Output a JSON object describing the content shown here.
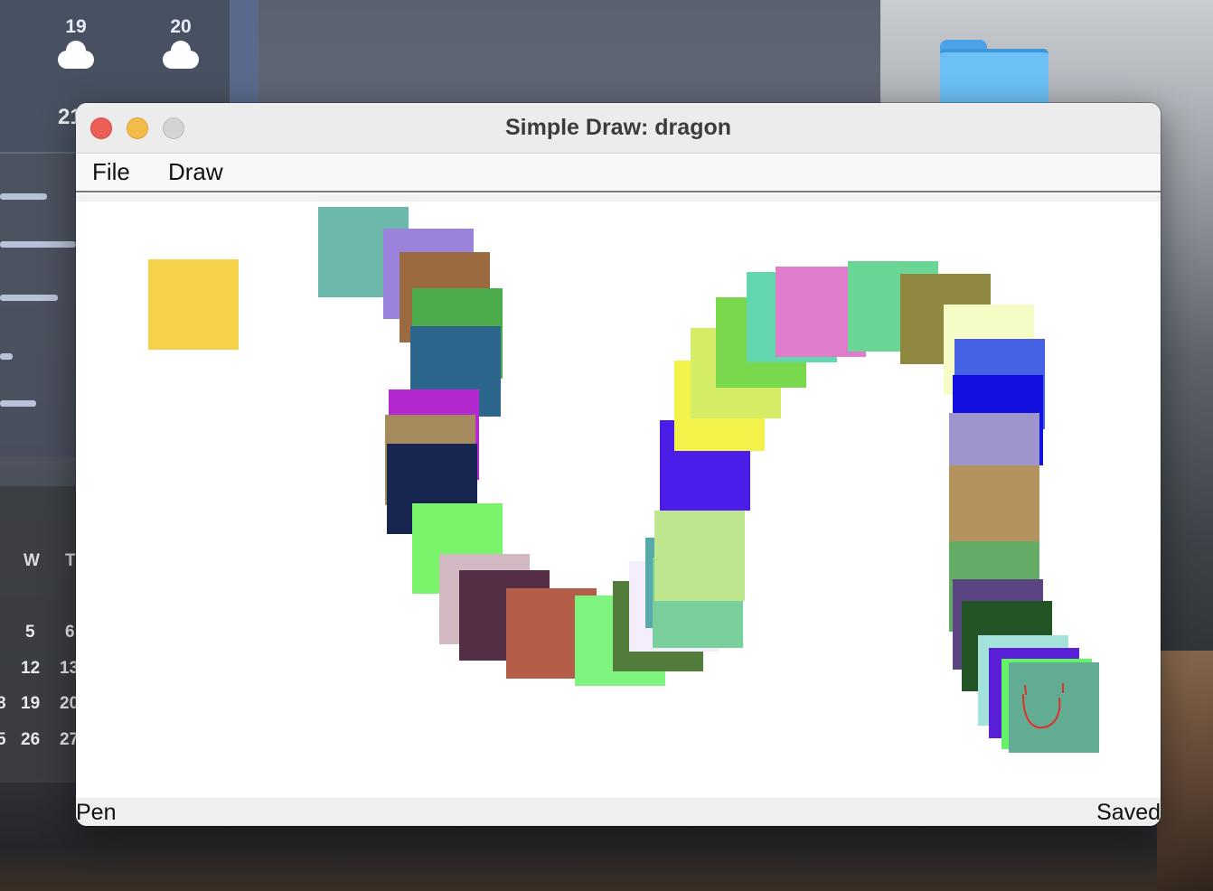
{
  "window": {
    "title": "Simple Draw: dragon"
  },
  "menubar": {
    "items": [
      "File",
      "Draw"
    ]
  },
  "status": {
    "mode": "Pen",
    "save_state": "Saved"
  },
  "desktop": {
    "weather": {
      "days": [
        "19",
        "20"
      ],
      "temp_partial": "21"
    },
    "calendar": {
      "headers": [
        "W",
        "T"
      ],
      "rows": [
        [
          "5",
          "6"
        ],
        [
          "12",
          "13"
        ],
        [
          "19",
          "20"
        ],
        [
          "26",
          "27"
        ]
      ],
      "partial_col": [
        "",
        "",
        "8",
        "5"
      ]
    }
  },
  "canvas": {
    "shapes": [
      {
        "color": "#f5d24a"
      },
      {
        "color": "#6cb8ac"
      },
      {
        "color": "#9b82dc"
      },
      {
        "color": "#9c6a40"
      },
      {
        "color": "#4cac4c"
      },
      {
        "color": "#2c668c"
      },
      {
        "color": "#b428d0"
      },
      {
        "color": "#a48a5c"
      },
      {
        "color": "#162650"
      },
      {
        "color": "#7af46a"
      },
      {
        "color": "#d2b8c0"
      },
      {
        "color": "#542e44"
      },
      {
        "color": "#b45e4a"
      },
      {
        "color": "#7ef47e"
      },
      {
        "color": "#527c3a"
      },
      {
        "color": "#f4eefc"
      },
      {
        "color": "#58aaaa"
      },
      {
        "color": "#7ad09c"
      },
      {
        "color": "#bee68e"
      },
      {
        "color": "#4c1ce8"
      },
      {
        "color": "#f2f24a"
      },
      {
        "color": "#d4ec66"
      },
      {
        "color": "#7ad84c"
      },
      {
        "color": "#62d6ac"
      },
      {
        "color": "#e07ccc"
      },
      {
        "color": "#6ad696"
      },
      {
        "color": "#908840"
      },
      {
        "color": "#f6fcc6"
      },
      {
        "color": "#4662e4"
      },
      {
        "color": "#1410e0"
      },
      {
        "color": "#9c96cc"
      },
      {
        "color": "#b4925e"
      },
      {
        "color": "#64ac66"
      },
      {
        "color": "#5a4482"
      },
      {
        "color": "#225426"
      },
      {
        "color": "#a4e2dc"
      },
      {
        "color": "#5a20d8"
      },
      {
        "color": "#64f266"
      },
      {
        "color": "#62ac94"
      }
    ],
    "smiley_color": "#e0302a"
  }
}
